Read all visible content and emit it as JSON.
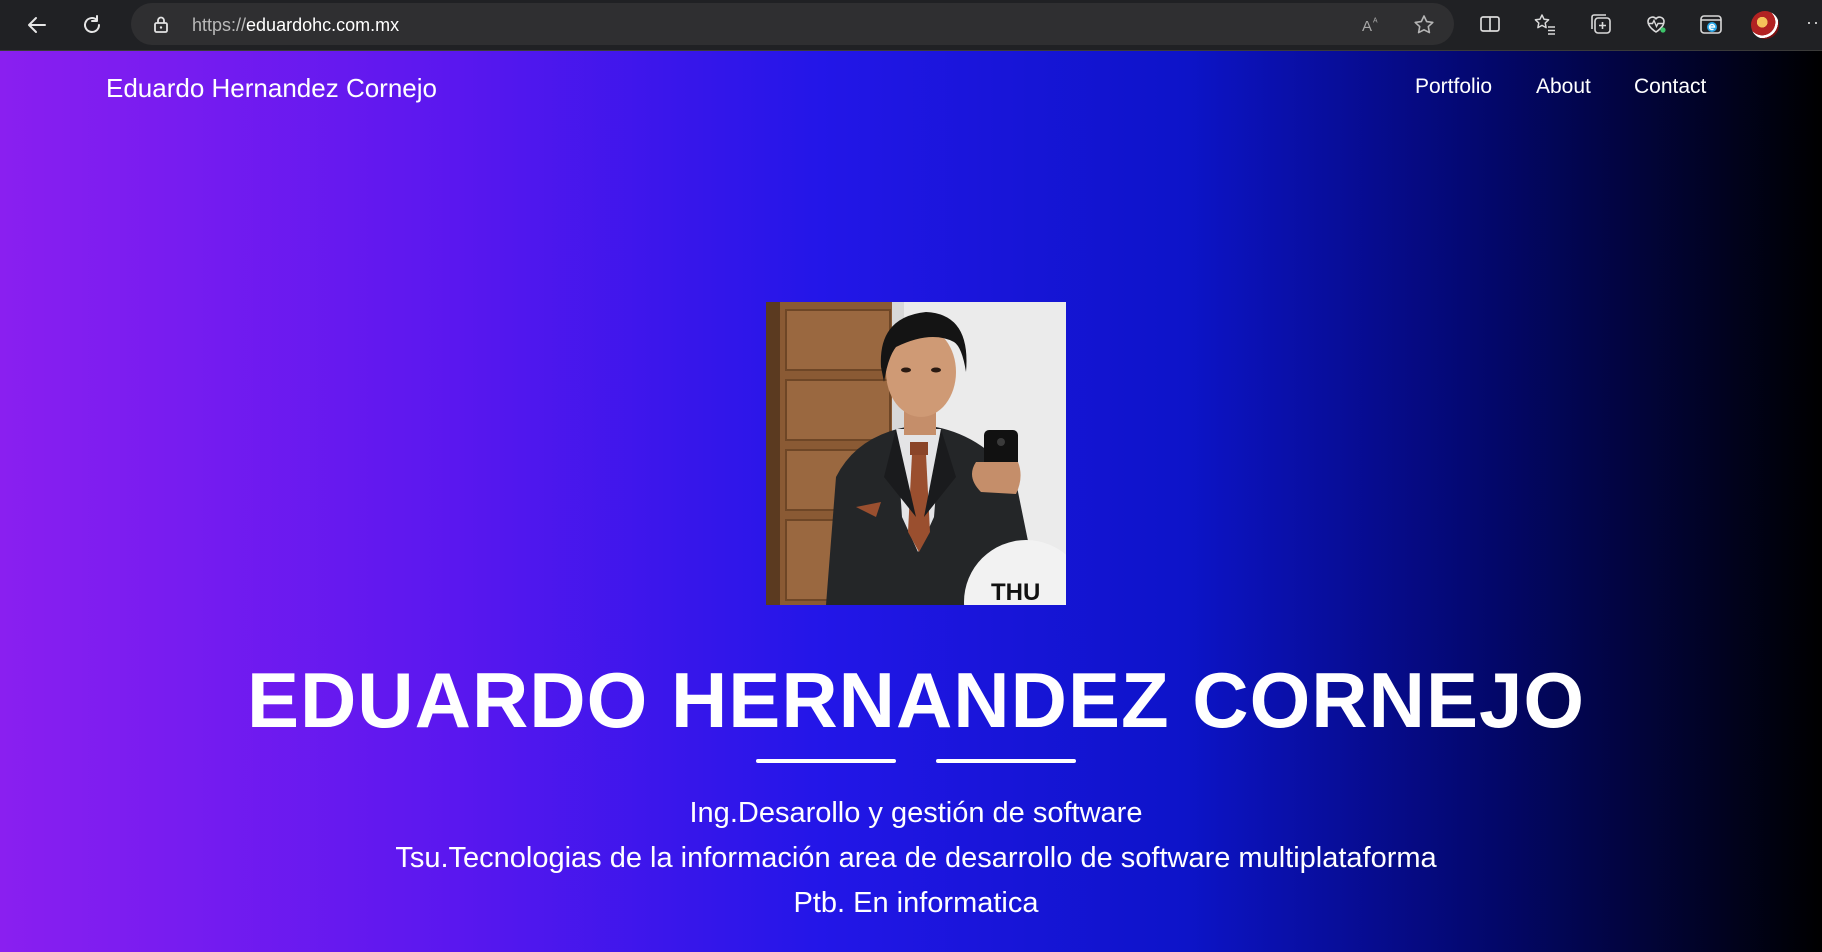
{
  "browser": {
    "url_scheme": "https://",
    "url_host": "eduardohc.com.mx",
    "icons": [
      "back-icon",
      "refresh-icon",
      "lock-icon",
      "read-aloud-icon",
      "favorite-star-icon",
      "split-screen-icon",
      "favorites-icon",
      "collections-icon",
      "performance-icon",
      "edge-icon",
      "profile-avatar",
      "more-icon"
    ]
  },
  "nav": {
    "brand": "Eduardo Hernandez Cornejo",
    "links": [
      {
        "label": "Portfolio"
      },
      {
        "label": "About"
      },
      {
        "label": "Contact"
      }
    ]
  },
  "hero": {
    "photo_badge": "THU",
    "title": "EDUARDO HERNANDEZ CORNEJO",
    "lines": [
      "Ing.Desarollo y gestión de software",
      "Tsu.Tecnologias de la información area de desarrollo de software multiplataforma",
      "Ptb. En informatica"
    ]
  },
  "colors": {
    "gradient_start": "#8a1ff0",
    "gradient_mid": "#2316e8",
    "gradient_end": "#000000",
    "browser_chrome": "#202124"
  }
}
